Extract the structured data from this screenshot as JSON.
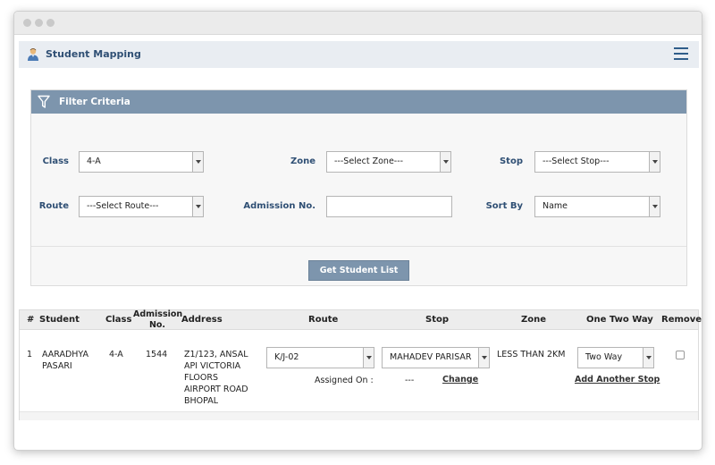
{
  "header": {
    "title": "Student Mapping"
  },
  "filter": {
    "title": "Filter Criteria",
    "class": {
      "label": "Class",
      "value": "4-A"
    },
    "zone": {
      "label": "Zone",
      "value": "---Select Zone---"
    },
    "stop": {
      "label": "Stop",
      "value": "---Select Stop---"
    },
    "route": {
      "label": "Route",
      "value": "---Select Route---"
    },
    "admission": {
      "label": "Admission No.",
      "value": ""
    },
    "sortby": {
      "label": "Sort By",
      "value": "Name"
    },
    "button_label": "Get Student List"
  },
  "table": {
    "columns": {
      "num": "#",
      "student": "Student",
      "class": "Class",
      "admission_l1": "Admission",
      "admission_l2": "No.",
      "address": "Address",
      "route": "Route",
      "stop": "Stop",
      "zone": "Zone",
      "way": "One Two Way",
      "remove": "Remove"
    },
    "rows": [
      {
        "num": "1",
        "student_l1": "AARADHYA",
        "student_l2": "PASARI",
        "class": "4-A",
        "admission": "1544",
        "address_l1": "Z1/123, ANSAL",
        "address_l2": "API VICTORIA",
        "address_l3": "FLOORS",
        "address_l4": "AIRPORT ROAD",
        "address_l5": "BHOPAL",
        "route": "K/J-02",
        "stop": "MAHADEV PARISAR",
        "zone": "LESS THAN 2KM",
        "way": "Two Way",
        "assigned_label": "Assigned On :",
        "assigned_value": "---",
        "change_label": "Change",
        "add_stop_label": "Add Another Stop",
        "remove_checked": false
      }
    ]
  },
  "colors": {
    "header_bg": "#7d95ad",
    "label_text": "#2f4f74"
  },
  "icons": [
    "user-icon",
    "hamburger-menu-icon",
    "filter-funnel-icon",
    "chevron-down-icon"
  ]
}
